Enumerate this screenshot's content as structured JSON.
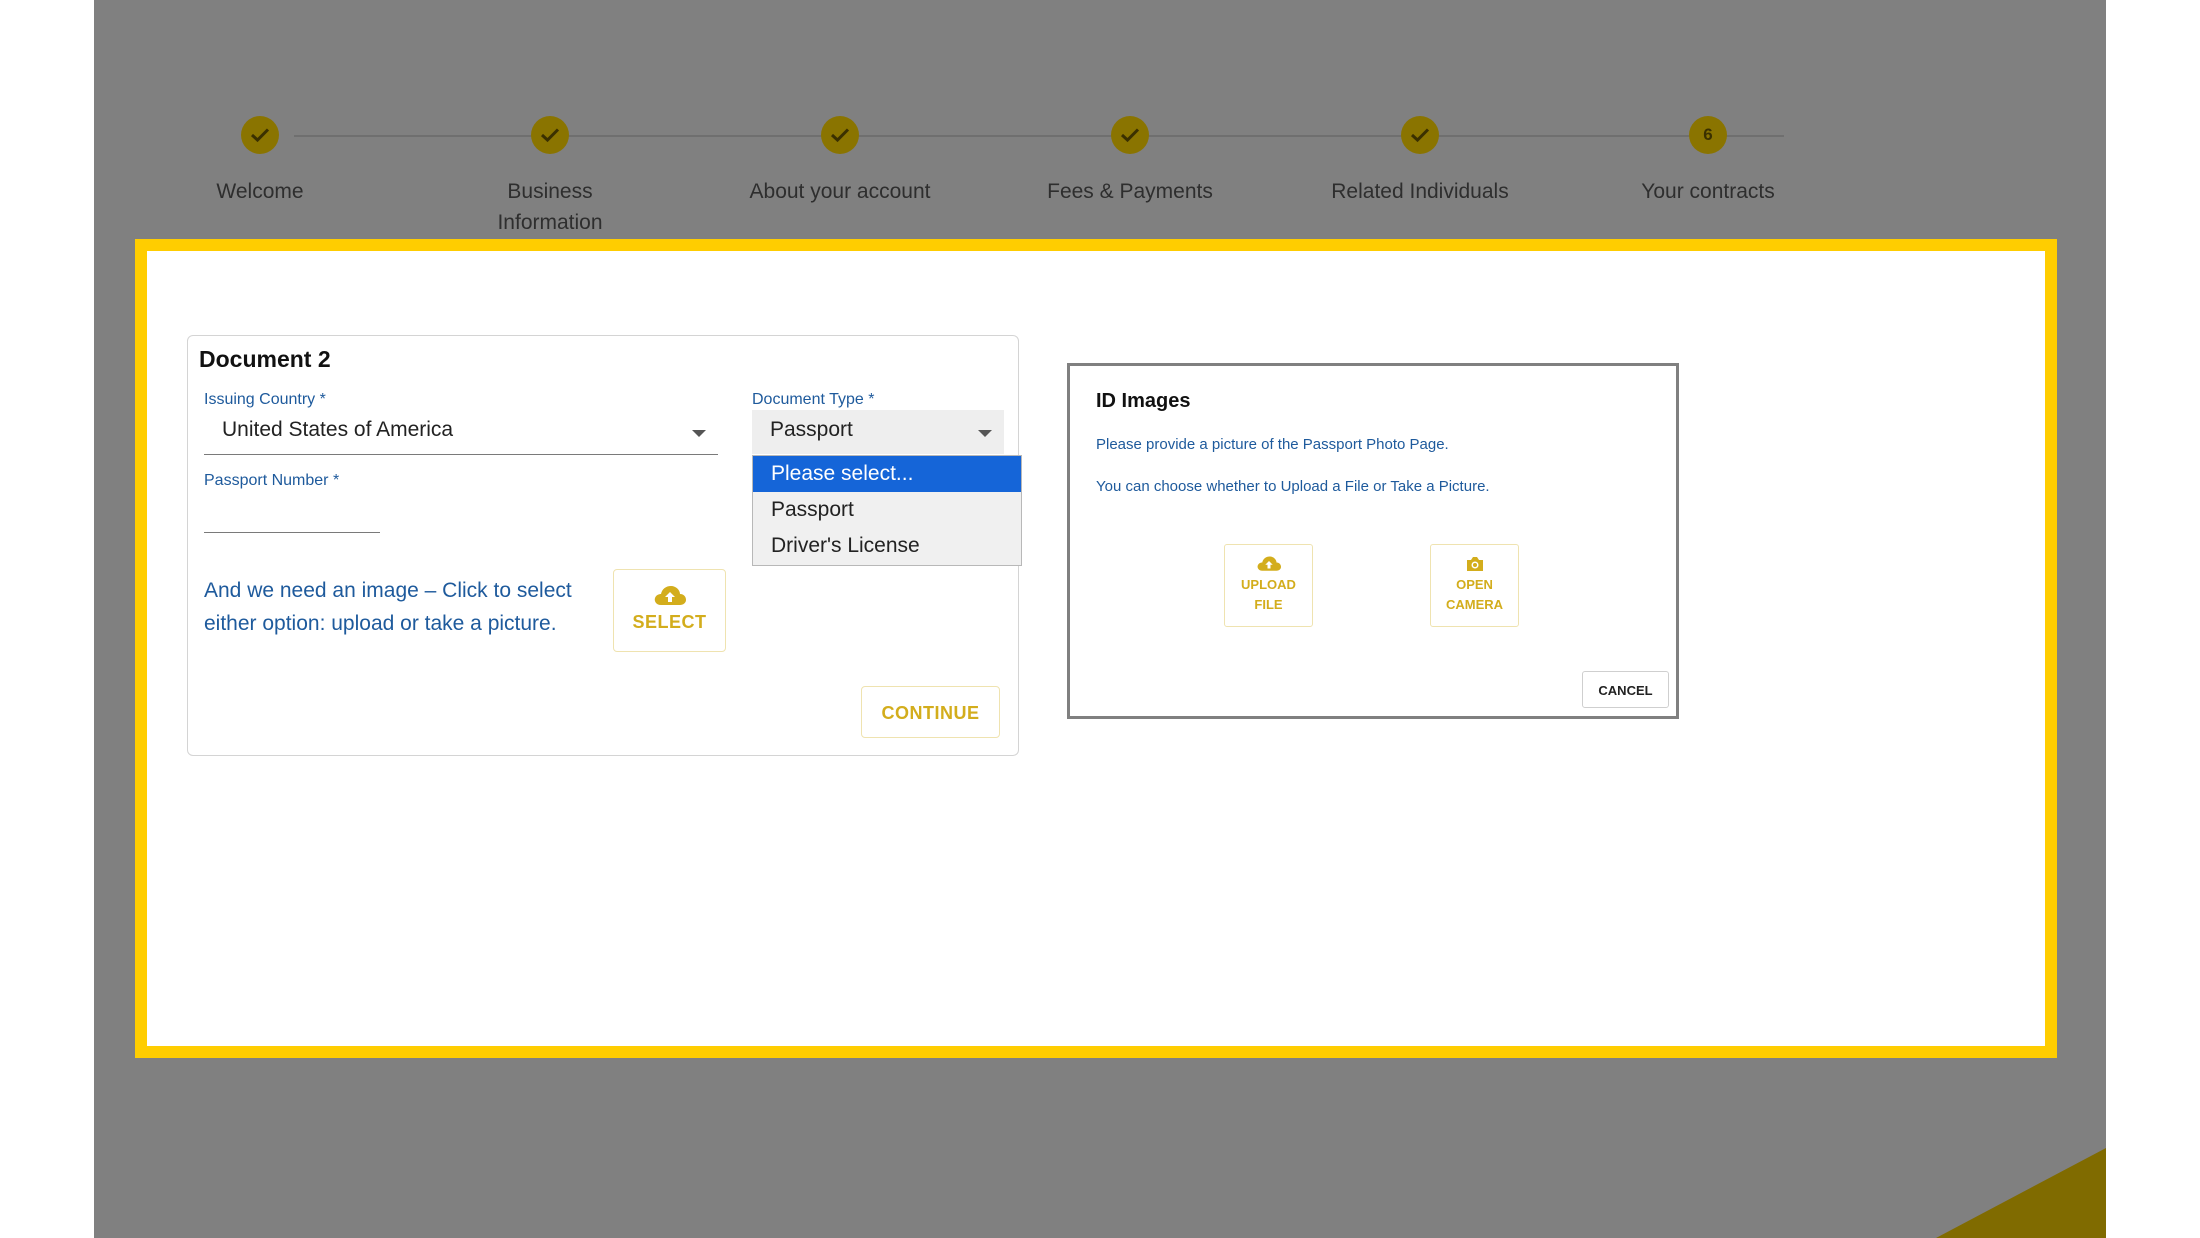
{
  "stepper": {
    "steps": [
      {
        "label": "Welcome",
        "state": "done"
      },
      {
        "label": "Business\nInformation",
        "state": "done"
      },
      {
        "label": "About your account",
        "state": "done"
      },
      {
        "label": "Fees & Payments",
        "state": "done"
      },
      {
        "label": "Related Individuals",
        "state": "done"
      },
      {
        "label": "Your contracts",
        "state": "current",
        "number": "6"
      }
    ]
  },
  "document": {
    "title": "Document 2",
    "issuing_country_label": "Issuing Country *",
    "issuing_country_value": "United States of America",
    "document_type_label": "Document Type *",
    "document_type_value": "Passport",
    "document_type_options": [
      "Please select...",
      "Passport",
      "Driver's License"
    ],
    "passport_number_label": "Passport Number *",
    "passport_number_value": "",
    "image_prompt": "And we need an image – Click to select either option: upload or take a picture.",
    "select_button": "SELECT",
    "continue_button": "CONTINUE"
  },
  "id_images": {
    "title": "ID Images",
    "instruction": "Please provide a picture of the Passport Photo Page.",
    "choice_text": "You can choose whether to Upload a File or Take a Picture.",
    "upload_line1": "UPLOAD",
    "upload_line2": "FILE",
    "camera_line1": "OPEN",
    "camera_line2": "CAMERA",
    "cancel_button": "CANCEL"
  },
  "colors": {
    "accent_gold": "#d3ad1c",
    "frame_yellow": "#ffcd00",
    "link_blue": "#1e5a9c",
    "selected_blue": "#1565d8",
    "overlay_grey": "#808080"
  }
}
